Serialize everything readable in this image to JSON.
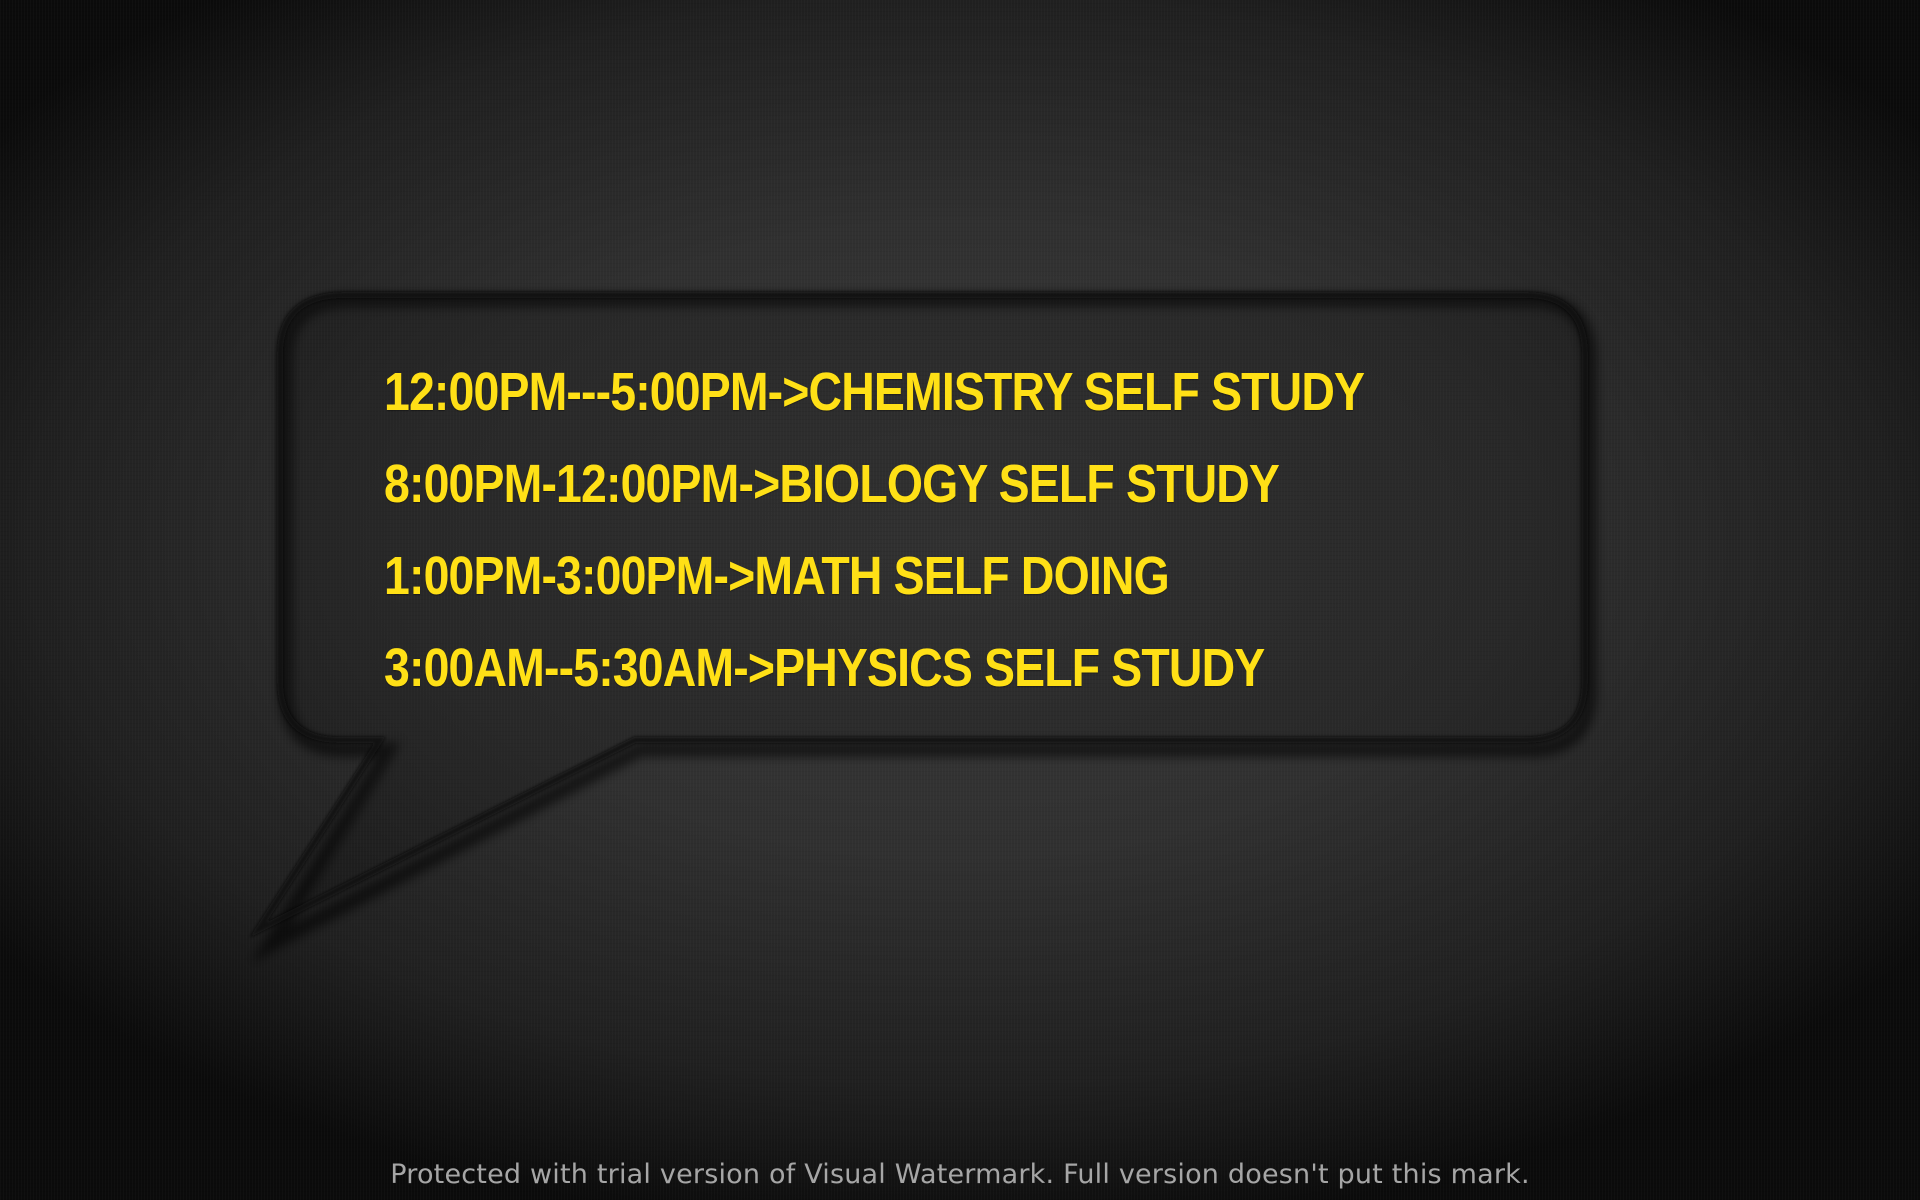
{
  "schedule": {
    "lines": [
      "12:00PM---5:00PM->CHEMISTRY SELF STUDY",
      "8:00PM-12:00PM->BIOLOGY SELF STUDY",
      "1:00PM-3:00PM->MATH SELF DOING",
      "3:00AM--5:30AM->PHYSICS SELF STUDY"
    ]
  },
  "watermark": {
    "text": "Protected with trial version of Visual Watermark. Full version doesn't put this mark."
  },
  "colors": {
    "text": "#ffe016",
    "background": "#2c2c2c",
    "watermark": "#a6a6a6"
  }
}
